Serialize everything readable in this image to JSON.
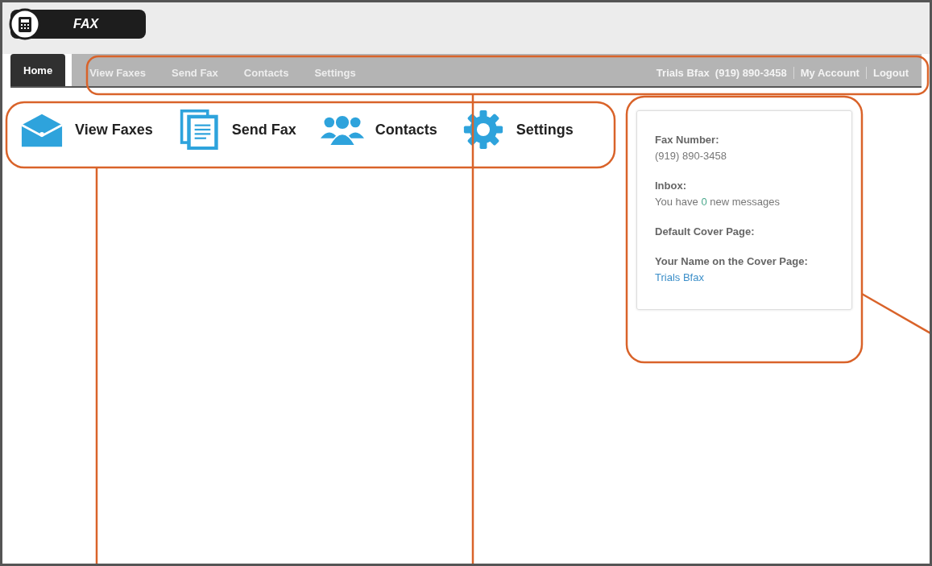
{
  "logo": {
    "title": "FAX"
  },
  "nav": {
    "tabs": [
      {
        "label": "Home",
        "selected": true
      },
      {
        "label": "View Faxes",
        "selected": false
      },
      {
        "label": "Send Fax",
        "selected": false
      },
      {
        "label": "Contacts",
        "selected": false
      },
      {
        "label": "Settings",
        "selected": false
      }
    ],
    "user": "Trials Bfax  (919) 890-3458",
    "links": [
      "My Account",
      "Logout"
    ]
  },
  "shortcuts": [
    {
      "label": "View Faxes",
      "kind": "envelope"
    },
    {
      "label": "Send Fax",
      "kind": "document"
    },
    {
      "label": "Contacts",
      "kind": "people"
    },
    {
      "label": "Settings",
      "kind": "gear"
    }
  ],
  "info": [
    {
      "label": "Fax Number:",
      "kind": "text",
      "value": "(919) 890-3458"
    },
    {
      "label": "Inbox:",
      "kind": "count",
      "before": "You have",
      "count": "0",
      "after": "new messages"
    },
    {
      "label": "Default Cover Page:",
      "kind": "empty"
    },
    {
      "label": "Your Name on the Cover Page:",
      "kind": "link",
      "value": "Trials Bfax"
    }
  ]
}
